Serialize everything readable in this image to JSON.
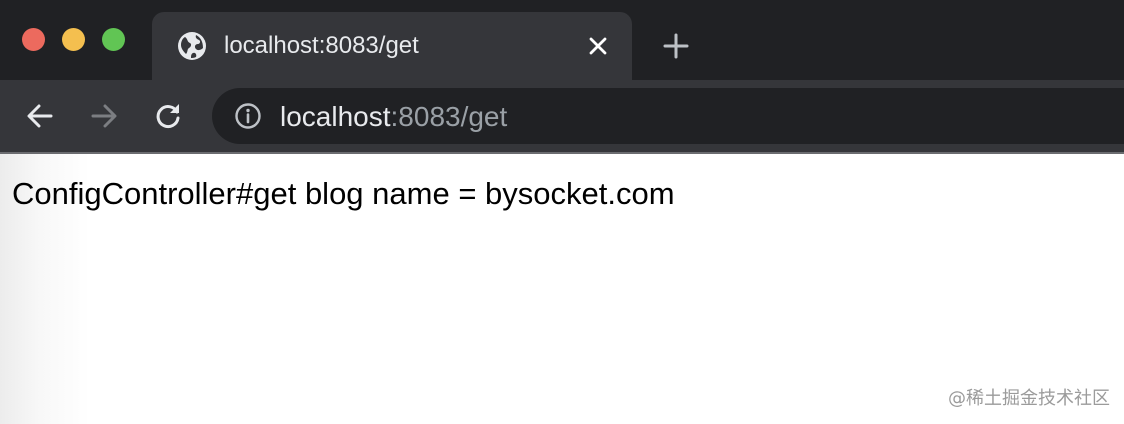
{
  "window_controls": {
    "close_color": "#ec6a5e",
    "minimize_color": "#f4bf4f",
    "zoom_color": "#61c554"
  },
  "tab": {
    "icon": "globe-icon",
    "title": "localhost:8083/get",
    "close_icon": "close-icon"
  },
  "new_tab": {
    "icon": "plus-icon"
  },
  "toolbar": {
    "back_icon": "arrow-left-icon",
    "forward_icon": "arrow-right-icon",
    "reload_icon": "reload-icon"
  },
  "address_bar": {
    "info_icon": "info-icon",
    "host": "localhost",
    "rest": ":8083/get"
  },
  "page": {
    "body_text": "ConfigController#get blog name = bysocket.com",
    "watermark": "@稀土掘金技术社区"
  }
}
